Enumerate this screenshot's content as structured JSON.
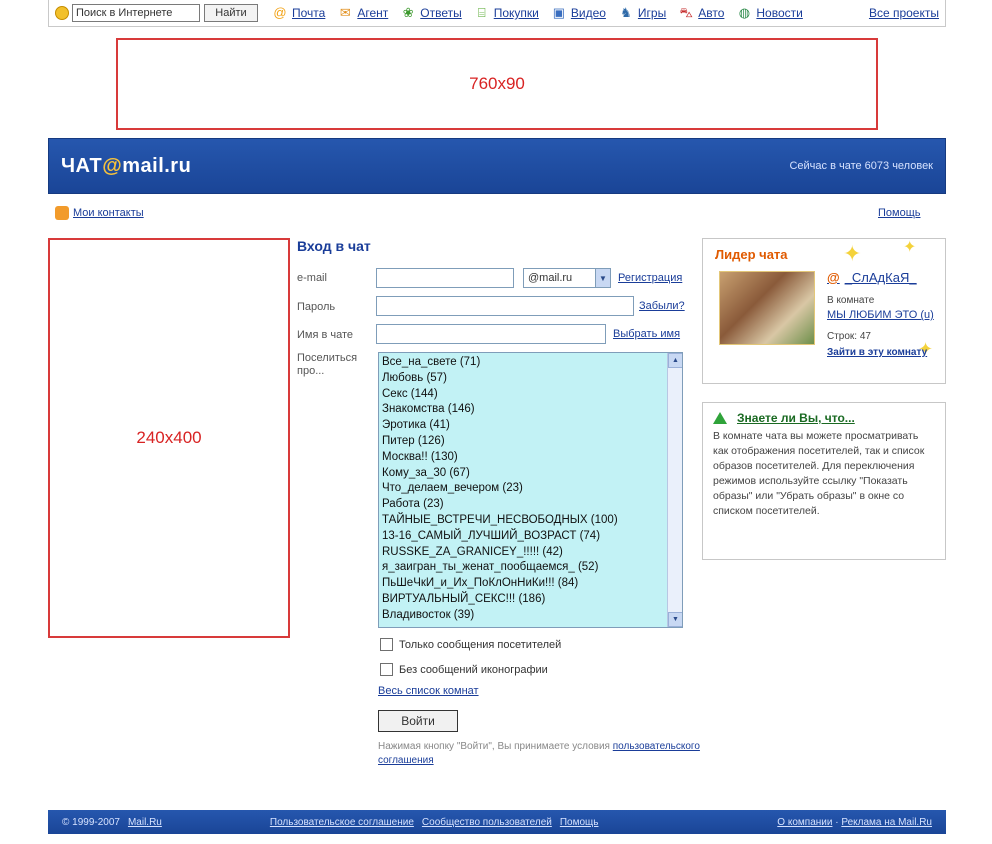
{
  "topbar": {
    "search_placeholder": "Поиск в Интернете",
    "find_label": "Найти",
    "projects": [
      {
        "label": "Почта",
        "icon": "mail-at-icon",
        "glyph": "@",
        "color": "#f2a214"
      },
      {
        "label": "Агент",
        "icon": "agent-envelope-icon",
        "glyph": "✉",
        "color": "#e2901e"
      },
      {
        "label": "Ответы",
        "icon": "answers-icon",
        "glyph": "❀",
        "color": "#3d9a2e"
      },
      {
        "label": "Покупки",
        "icon": "shopping-icon",
        "glyph": "⌸",
        "color": "#4aa321"
      },
      {
        "label": "Видео",
        "icon": "video-icon",
        "glyph": "▣",
        "color": "#3a6ebf"
      },
      {
        "label": "Игры",
        "icon": "games-icon",
        "glyph": "♞",
        "color": "#2e6aa8"
      },
      {
        "label": "Авто",
        "icon": "auto-icon",
        "glyph": "⛍",
        "color": "#c52b2b"
      },
      {
        "label": "Новости",
        "icon": "news-globe-icon",
        "glyph": "◍",
        "color": "#2c8a49"
      }
    ],
    "all_projects": "Все проекты"
  },
  "banners": {
    "top": "760x90",
    "left": "240x400"
  },
  "header": {
    "logo_prefix": "ЧАТ",
    "logo_at": "@",
    "logo_suffix": "mail.ru",
    "online": "Сейчас в чате 6073 человек"
  },
  "links": {
    "my_contacts": "Мои контакты",
    "help": "Помощь"
  },
  "form": {
    "title": "Вход в чат",
    "email_label": "e-mail",
    "domain": "@mail.ru",
    "register": "Регистрация",
    "password_label": "Пароль",
    "forgot": "Забыли?",
    "nick_label": "Имя в чате",
    "choose_nick": "Выбрать имя",
    "rooms_label": "Поселиться про...",
    "rooms": [
      "Все_на_свете (71)",
      "Любовь (57)",
      "Секс (144)",
      "Знакомства (146)",
      "Эротика (41)",
      "Питер (126)",
      "Москва!! (130)",
      "Кому_за_30 (67)",
      "Что_делаем_вечером (23)",
      "Работа (23)",
      "ТАЙНЫЕ_ВСТРЕЧИ_НЕСВОБОДНЫХ (100)",
      "13-16_САМЫЙ_ЛУЧШИЙ_ВОЗРАСТ (74)",
      "RUSSKE_ZA_GRANICEY_!!!!! (42)",
      "я_заигран_ты_женат_пообщаемся_ (52)",
      "ПьШеЧкИ_и_Их_ПоКлОнНиКи!!! (84)",
      "ВИРТУАЛЬНЫЙ_СЕКС!!! (186)",
      "Владивосток (39)"
    ],
    "only_visitors": "Только сообщения посетителей",
    "no_system": "Без сообщений иконографии",
    "full_list": "Весь список комнат",
    "enter": "Войти",
    "terms": "Нажимая кнопку \"Войти\", Вы принимаете условия",
    "terms_link": "пользовательского соглашения"
  },
  "leader": {
    "title": "Лидер чата",
    "nick": "_СлАдКаЯ_",
    "in_room": "В комнате",
    "room": "МЫ ЛЮБИМ ЭТО (u)",
    "wrote": "Строк: 47",
    "reply": "Зайти в эту комнату"
  },
  "tip": {
    "title": "Знаете ли Вы, что...",
    "text": "В комнате чата вы можете просматривать как отображения посетителей, так и список образов посетителей. Для переключения режимов используйте ссылку \"Показать образы\" или \"Убрать образы\" в окне со списком посетителей."
  },
  "footer": {
    "copyright": "© 1999-2007",
    "company": "Mail.Ru",
    "user_agreement": "Пользовательское соглашение",
    "community": "Сообщество пользователей",
    "help": "Помощь",
    "about": "О компании",
    "advertising": "Реклама на Mail.Ru"
  }
}
